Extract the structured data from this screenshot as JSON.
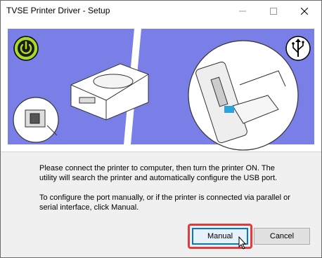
{
  "window": {
    "title": "TVSE Printer Driver - Setup"
  },
  "titlebar": {
    "min_icon": "minimize-icon",
    "max_icon": "maximize-icon",
    "close_icon": "close-icon"
  },
  "banner": {
    "background_color": "#7a7fe8",
    "icons": [
      "power-icon",
      "usb-icon"
    ]
  },
  "message": {
    "line1": "Please connect the printer to computer, then turn the printer ON. The utility will search the printer and automatically configure the USB port.",
    "line2": "To configure the port manually, or if the printer is connected via parallel or serial interface, click Manual."
  },
  "buttons": {
    "manual_label": "Manual",
    "cancel_label": "Cancel"
  },
  "colors": {
    "highlight": "#e23b3b",
    "accent": "#0078d7",
    "power_green": "#a8d82a"
  }
}
